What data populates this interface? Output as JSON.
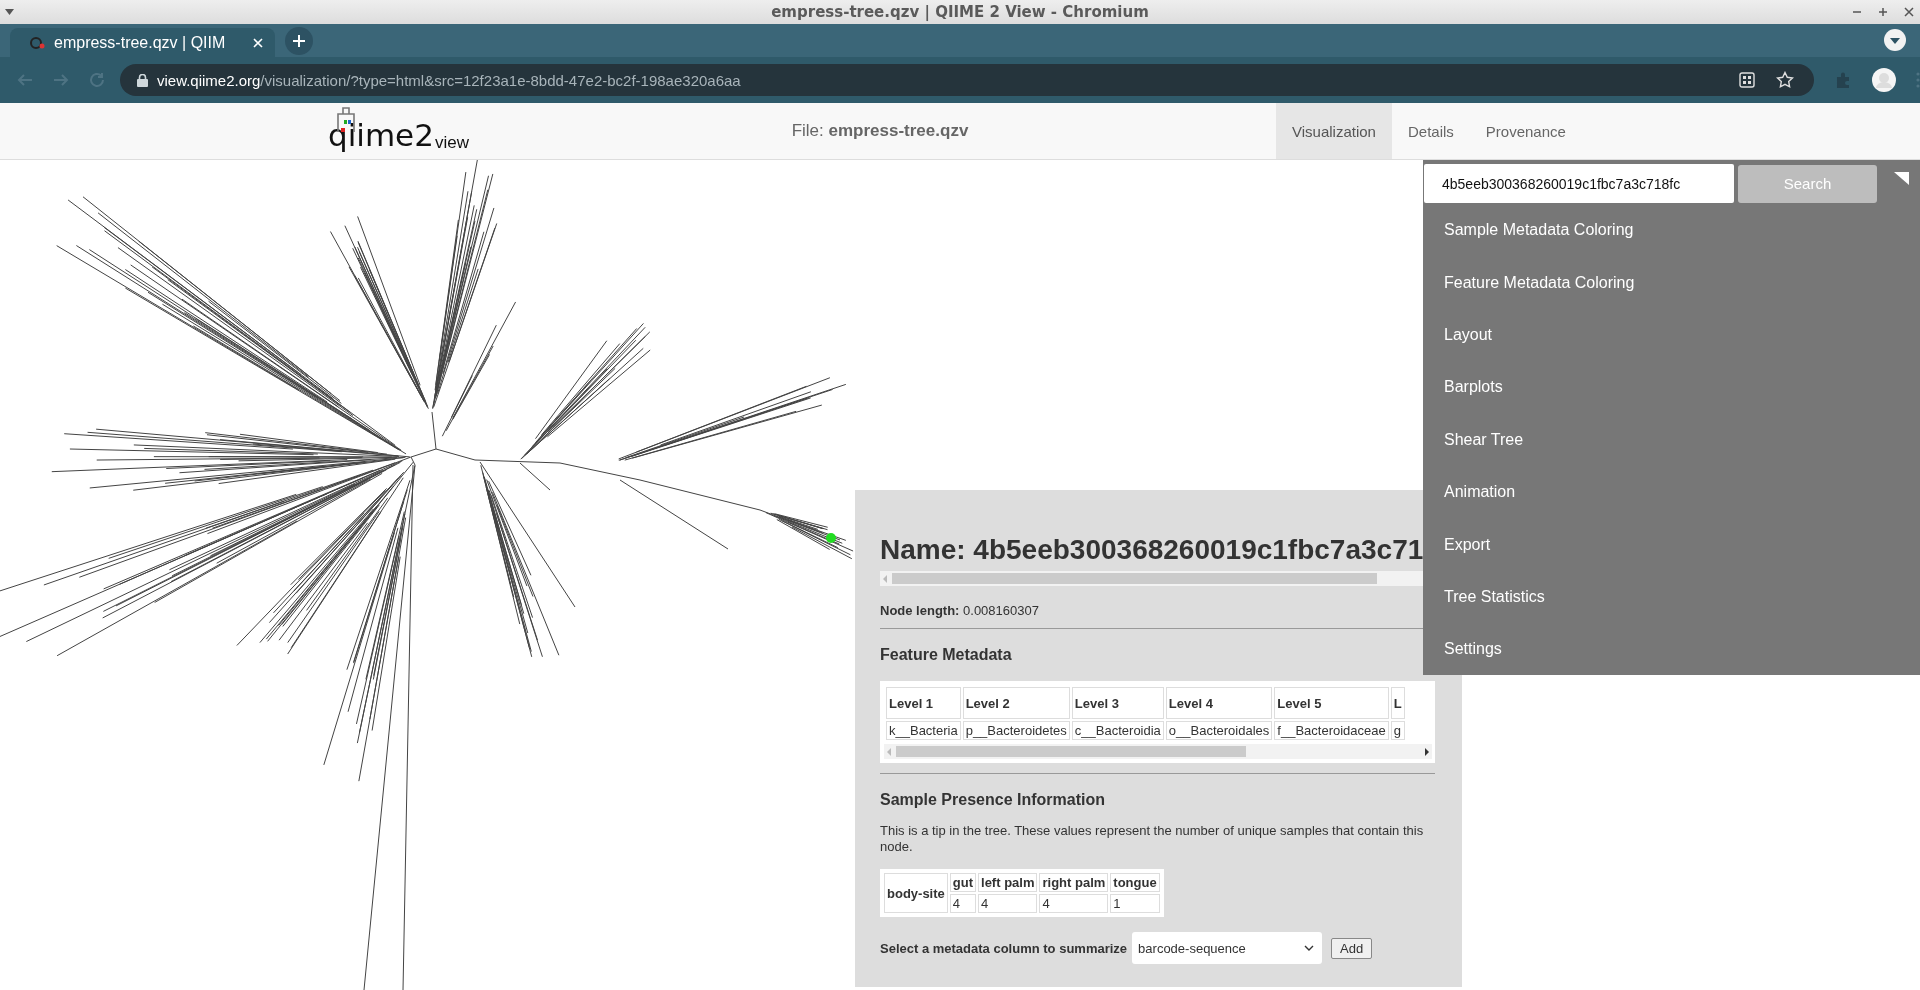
{
  "window": {
    "title": "empress-tree.qzv | QIIME 2 View - Chromium"
  },
  "browser": {
    "tabs": [
      {
        "title": "empress-tree.qzv | QIIM",
        "selected": true
      }
    ],
    "url": {
      "host": "view.qiime2.org",
      "path": "/visualization/?type=html&src=12f23a1e-8bdd-47e2-bc2f-198ae320a6aa"
    }
  },
  "header": {
    "logo": {
      "main": "qiime2",
      "sub": "view"
    },
    "file": "File: **empress-tree.qzv**",
    "nav": [
      {
        "label": "Visualization",
        "selected": true
      },
      {
        "label": "Details",
        "selected": false
      },
      {
        "label": "Provenance",
        "selected": false
      }
    ]
  },
  "search": {
    "value": "4b5eeb300368260019c1fbc7a3c718fc",
    "button": "Search"
  },
  "menu": [
    "Sample Metadata Coloring",
    "Feature Metadata Coloring",
    "Layout",
    "Barplots",
    "Shear Tree",
    "Animation",
    "Export",
    "Tree Statistics",
    "Settings"
  ],
  "node_panel": {
    "name": "Name: 4b5eeb300368260019c1fbc7a3c71",
    "node_length": "**Node length:** 0.008160307",
    "feature_metadata": {
      "title": "Feature Metadata",
      "columns": [
        "Level 1",
        "Level 2",
        "Level 3",
        "Level 4",
        "Level 5",
        "L"
      ],
      "row": [
        "k__Bacteria",
        "p__Bacteroidetes",
        "c__Bacteroidia",
        "o__Bacteroidales",
        "f__Bacteroidaceae",
        "g"
      ]
    },
    "sample_presence": {
      "title": "Sample Presence Information",
      "description": "This is a tip in the tree. These values represent the number of unique samples that contain this node.",
      "group": "body-site",
      "columns": [
        "gut",
        "left palm",
        "right palm",
        "tongue"
      ],
      "values": [
        "4",
        "4",
        "4",
        "1"
      ]
    },
    "summarize": {
      "label": "Select a metadata column to summarize",
      "value": "barcode-sequence",
      "button": "Add"
    }
  }
}
